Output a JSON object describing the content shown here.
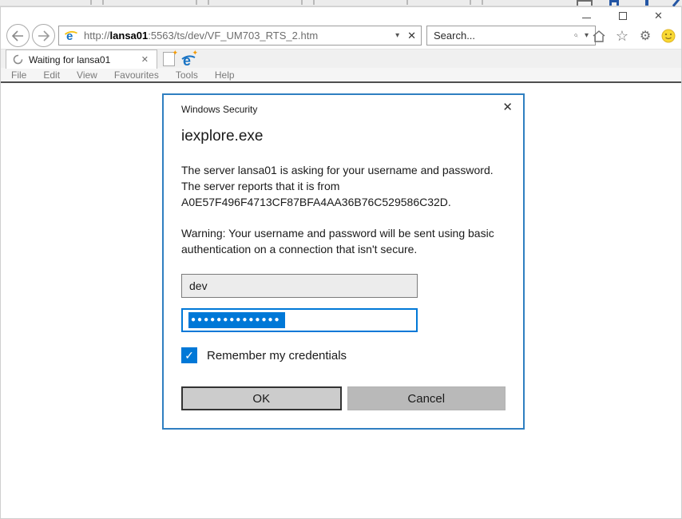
{
  "browser": {
    "tab": {
      "title": "Waiting for lansa01"
    },
    "menu_items": [
      "File",
      "Edit",
      "View",
      "Favourites",
      "Tools",
      "Help"
    ],
    "address_bar": {
      "prefix": "http://",
      "host": "lansa01",
      "path": ":5563/ts/dev/VF_UM703_RTS_2.htm"
    },
    "search": {
      "placeholder": "Search..."
    }
  },
  "dialog": {
    "title": "Windows Security",
    "app_name": "iexplore.exe",
    "message": "The server lansa01 is asking for your username and password. The server reports that it is from A0E57F496F4713CF87BFA4AA36B76C529586C32D.",
    "warning": "Warning: Your username and password will be sent using basic authentication on a connection that isn't secure.",
    "username_value": "dev",
    "password_masked": "●●●●●●●●●●●●●●",
    "checkbox_label": "Remember my credentials",
    "ok_label": "OK",
    "cancel_label": "Cancel"
  },
  "icons": {
    "close_glyph": "✕",
    "dropdown_glyph": "▾",
    "check_glyph": "✓",
    "star_glyph": "☆",
    "gear_glyph": "⚙",
    "new_tab_star_glyph": "✦"
  },
  "colors": {
    "accent": "#0078d7",
    "dialog_border": "#2f7fc1",
    "selection": "#0078d7"
  }
}
